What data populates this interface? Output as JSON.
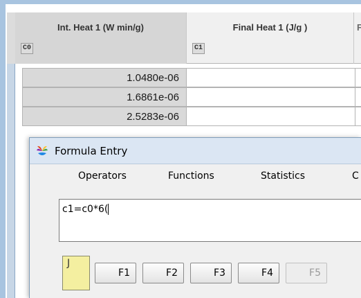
{
  "columns": [
    {
      "title": "Int. Heat 1  (W min/g)",
      "tag": "C0"
    },
    {
      "title": "Final Heat 1  (J/g )",
      "tag": "C1"
    },
    {
      "title": "F",
      "tag": ""
    }
  ],
  "rows": [
    {
      "c0": "1.0480e-06"
    },
    {
      "c0": "1.6861e-06"
    },
    {
      "c0": "2.5283e-06"
    }
  ],
  "dialog": {
    "title": "Formula Entry",
    "icon": "app-flower-icon",
    "menu": [
      "Operators",
      "Functions",
      "Statistics",
      "C"
    ],
    "formula": "c1=c0*6(",
    "sticky_glyph": "J",
    "fkeys": [
      "F1",
      "F2",
      "F3",
      "F4",
      "F5"
    ]
  },
  "colors": {
    "frame": "#a8c4e0",
    "selected_column": "#d6d6d6",
    "sticky_note": "#f4efa0",
    "titlebar": "#dbe6f3"
  }
}
